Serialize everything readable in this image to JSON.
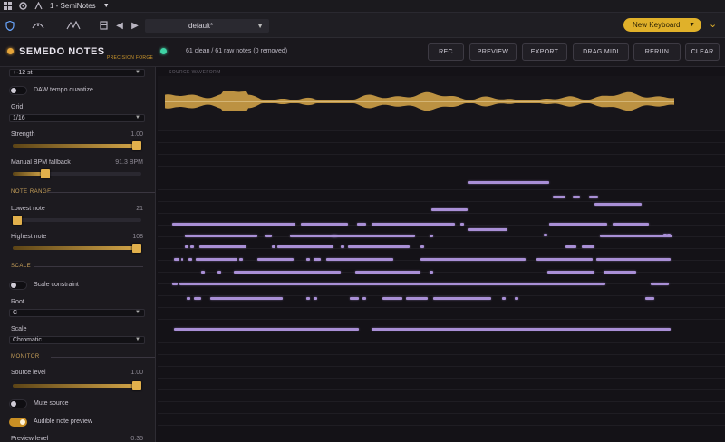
{
  "host": {
    "title": "1 - SemiNotes",
    "preset": "default*",
    "keyboard_button": "New Keyboard"
  },
  "plugin": {
    "title": "SEMEDO NOTES",
    "subtitle": "PRECISION FORGE",
    "status": "61 clean / 61 raw notes (0 removed)",
    "buttons": [
      "REC",
      "PREVIEW",
      "EXPORT",
      "DRAG MIDI",
      "RERUN",
      "CLEAR"
    ]
  },
  "sidebar": {
    "top_select": "+-12 st",
    "daw_tempo": {
      "label": "DAW tempo quantize",
      "on": false
    },
    "grid": {
      "label": "Grid",
      "value": "1/16"
    },
    "strength": {
      "label": "Strength",
      "value": "1.00",
      "level": 1.0
    },
    "manual_bpm": {
      "label": "Manual BPM fallback",
      "value": "91.3 BPM",
      "level": 0.25
    },
    "note_range_section": "NOTE RANGE",
    "lowest_note": {
      "label": "Lowest note",
      "value": "21",
      "level": 0.0
    },
    "highest_note": {
      "label": "Highest note",
      "value": "108",
      "level": 1.0
    },
    "scale_section": "SCALE",
    "scale_constraint": {
      "label": "Scale constraint",
      "on": false
    },
    "root": {
      "label": "Root",
      "value": "C"
    },
    "scale": {
      "label": "Scale",
      "value": "Chromatic"
    },
    "monitor_section": "MONITOR",
    "source_level": {
      "label": "Source level",
      "value": "1.00",
      "level": 1.0
    },
    "mute_source": {
      "label": "Mute source",
      "on": false
    },
    "audible_preview": {
      "label": "Audible note preview",
      "on": true
    },
    "preview_level": {
      "label": "Preview level",
      "value": "0.35"
    }
  },
  "editor": {
    "waveform_label": "SOURCE WAVEFORM"
  },
  "colors": {
    "accent": "#e0b12a",
    "note": "#a98fd6",
    "waveform": "#d9a84a",
    "led": "#3fd3a5"
  }
}
